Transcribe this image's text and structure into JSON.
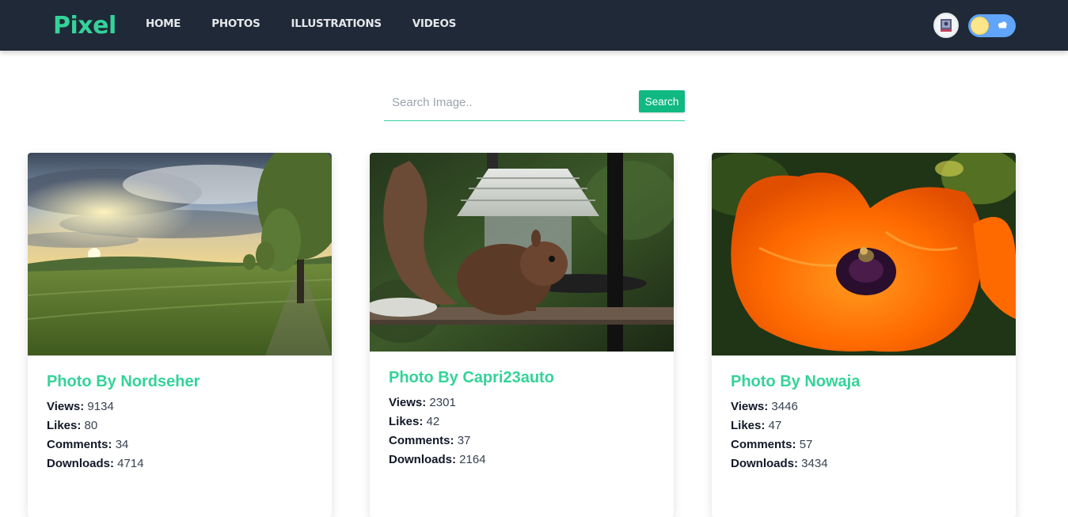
{
  "nav": {
    "logo": "Pixel",
    "links": [
      "HOME",
      "PHOTOS",
      "ILLUSTRATIONS",
      "VIDEOS"
    ]
  },
  "search": {
    "placeholder": "Search Image..",
    "value": "",
    "button_label": "Search"
  },
  "stat_labels": {
    "views": "Views:",
    "likes": "Likes:",
    "comments": "Comments:",
    "downloads": "Downloads:"
  },
  "cards": [
    {
      "title": "Photo By Nordseher",
      "views": "9134",
      "likes": "80",
      "comments": "34",
      "downloads": "4714"
    },
    {
      "title": "Photo By Capri23auto",
      "views": "2301",
      "likes": "42",
      "comments": "37",
      "downloads": "2164"
    },
    {
      "title": "Photo By Nowaja",
      "views": "3446",
      "likes": "47",
      "comments": "57",
      "downloads": "3434"
    }
  ],
  "colors": {
    "navbar": "#1f2937",
    "brand": "#34d399",
    "search_button": "#10b981",
    "toggle": "#60a5fa"
  },
  "icons": {
    "avatar": "user-avatar",
    "theme_toggle": "sun-cloud-toggle-icon"
  }
}
